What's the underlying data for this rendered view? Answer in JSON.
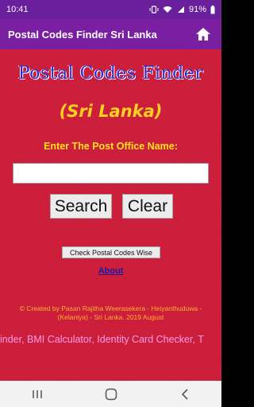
{
  "status_bar": {
    "time": "10:41",
    "battery": "91%"
  },
  "app_bar": {
    "title": "Postal Codes Finder Sri Lanka",
    "home_icon": "home-icon"
  },
  "main": {
    "heading": "Postal Codes Finder",
    "subheading": "(Sri Lanka)",
    "prompt": "Enter The Post Office Name:",
    "input_value": "",
    "search_label": "Search",
    "clear_label": "Clear",
    "postal_codes_wise_label": "Check Postal Codes Wise",
    "about_label": "About",
    "credit": "© Created by Pasan Rajitha Weerasekera - Heiyanthuduwa - (Kelaniya) - Sri Lanka. 2019 August",
    "marquee": "inder, BMI Calculator, Identity Card Checker, T"
  },
  "colors": {
    "status_bar": "#6a1f9c",
    "app_bar": "#7b1fa2",
    "background": "#d01f3d",
    "heading": "#2a2ac8",
    "subheading": "#ffd21f",
    "prompt": "#ffe21f",
    "about_link": "#1a1aa8",
    "credit": "#ffb02e",
    "marquee": "#ff9be6"
  },
  "nav_bar": {
    "recents_icon": "recents-icon",
    "home_icon": "nav-home-icon",
    "back_icon": "back-icon"
  }
}
